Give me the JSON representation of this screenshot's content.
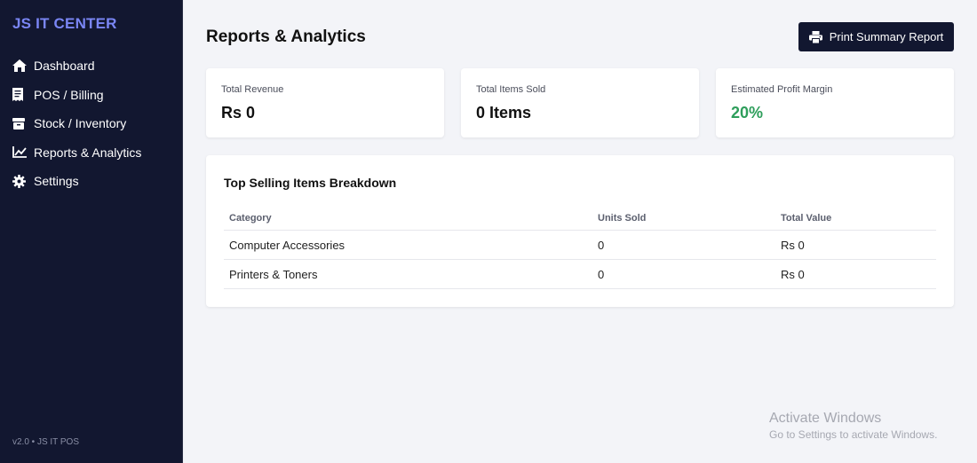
{
  "brand": "JS IT CENTER",
  "nav": [
    {
      "label": "Dashboard",
      "icon": "home-icon"
    },
    {
      "label": "POS / Billing",
      "icon": "receipt-icon"
    },
    {
      "label": "Stock / Inventory",
      "icon": "box-icon"
    },
    {
      "label": "Reports & Analytics",
      "icon": "chart-line-icon"
    },
    {
      "label": "Settings",
      "icon": "gear-icon"
    }
  ],
  "version": "v2.0 • JS IT POS",
  "page_title": "Reports & Analytics",
  "print_button": "Print Summary Report",
  "cards": [
    {
      "label": "Total Revenue",
      "value": "Rs 0"
    },
    {
      "label": "Total Items Sold",
      "value": "0 Items"
    },
    {
      "label": "Estimated Profit Margin",
      "value": "20%"
    }
  ],
  "panel": {
    "title": "Top Selling Items Breakdown",
    "columns": [
      "Category",
      "Units Sold",
      "Total Value"
    ],
    "rows": [
      [
        "Computer Accessories",
        "0",
        "Rs 0"
      ],
      [
        "Printers & Toners",
        "0",
        "Rs 0"
      ]
    ]
  },
  "watermark": {
    "title": "Activate Windows",
    "subtitle": "Go to Settings to activate Windows."
  },
  "colors": {
    "sidebar_bg": "#121730",
    "brand": "#7a86f5",
    "profit_green": "#2e9e5b",
    "page_bg": "#f3f4f8"
  }
}
